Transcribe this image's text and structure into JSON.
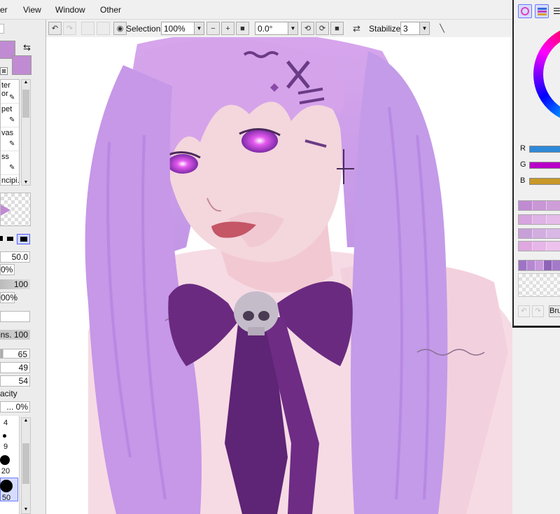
{
  "menu": [
    "er",
    "View",
    "Window",
    "Other"
  ],
  "toolbar": {
    "selection_label": "Selection",
    "zoom_value": "100%",
    "rotation_value": "0.0°",
    "stabilizer_label": "Stabilizer",
    "stabilizer_value": "3"
  },
  "left_panel": {
    "tool_list": [
      "ter\nor",
      "pet",
      "vas",
      "ss",
      "ncipi..."
    ],
    "fields": [
      "50.0",
      "0%",
      "100",
      "00%",
      "ns. 100",
      "65",
      "49",
      "54",
      "acity",
      "... 0%"
    ],
    "brush_sizes": [
      "4",
      "9",
      "20",
      "50"
    ]
  },
  "right_panel": {
    "slider_labels": [
      "R",
      "G",
      "B"
    ],
    "button_label": "Bru"
  },
  "colors": {
    "swatch": "#c08bd2",
    "hair": "#c99ae6",
    "bow": "#6a2a80",
    "skin": "#f3d3dc"
  },
  "icons": [
    "undo-icon",
    "redo-icon",
    "eye-icon",
    "zoom-out-icon",
    "zoom-in-icon",
    "zoom-reset-icon",
    "rotate-left-icon",
    "rotate-right-icon",
    "rotate-reset-icon",
    "flip-icon",
    "pen-icon",
    "swap-icon",
    "color-wheel-icon",
    "color-slider-icon"
  ]
}
